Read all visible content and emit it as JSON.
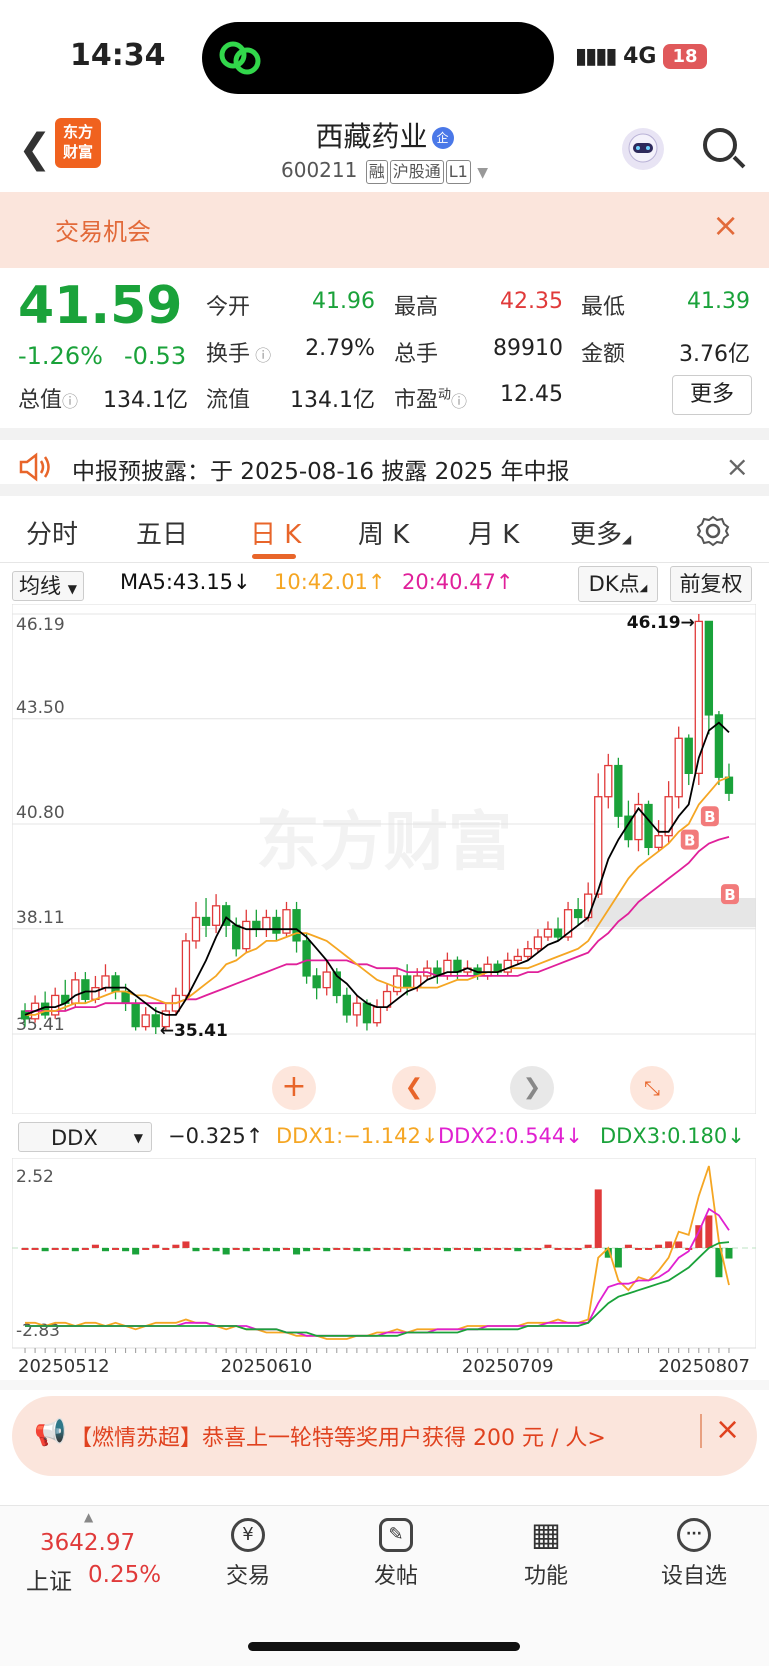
{
  "status": {
    "time": "14:34",
    "network": "4G",
    "battery": "18"
  },
  "header": {
    "logo": "东方\n财富",
    "stock_name": "西藏药业",
    "qi_badge": "企",
    "code": "600211",
    "tags": [
      "融",
      "沪股通",
      "L1"
    ]
  },
  "banner": {
    "text": "交易机会",
    "close": "×"
  },
  "quote": {
    "price": "41.59",
    "change_pct": "-1.26%",
    "change_amt": "-0.53",
    "items": [
      {
        "label": "今开",
        "value": "41.96",
        "color": "#1aa23a"
      },
      {
        "label": "最高",
        "value": "42.35",
        "color": "#e03a3a"
      },
      {
        "label": "最低",
        "value": "41.39",
        "color": "#1aa23a"
      },
      {
        "label": "换手",
        "value": "2.79%",
        "color": "#222222"
      },
      {
        "label": "总手",
        "value": "89910",
        "color": "#222222"
      },
      {
        "label": "金额",
        "value": "3.76亿",
        "color": "#222222"
      },
      {
        "label": "总值",
        "value": "134.1亿",
        "color": "#222222"
      },
      {
        "label": "流值",
        "value": "134.1亿",
        "color": "#222222"
      },
      {
        "label": "市盈",
        "value": "12.45",
        "color": "#222222"
      }
    ],
    "dyn_sup": "动",
    "more": "更多"
  },
  "notice": {
    "text": "中报预披露：于 2025-08-16 披露 2025 年中报",
    "close": "×"
  },
  "tabs": [
    "分时",
    "五日",
    "日 K",
    "周 K",
    "月 K",
    "更多"
  ],
  "active_tab": "日 K",
  "ma_bar": {
    "selector": "均线",
    "ma5": "MA5:43.15↓",
    "ma10": "10:42.01↑",
    "ma20": "20:40.47↑",
    "dk": "DK点",
    "fq": "前复权"
  },
  "ddx_bar": {
    "selector": "DDX",
    "ddx": "−0.325↑",
    "ddx1": "DDX1:−1.142↓",
    "ddx2": "DDX2:0.544↓",
    "ddx3": "DDX3:0.180↓"
  },
  "watermark": "东方财富",
  "chart_data": [
    {
      "type": "candlestick",
      "y_ticks": [
        "46.19",
        "43.50",
        "40.80",
        "38.11",
        "35.41"
      ],
      "ylim": [
        35.41,
        46.19
      ],
      "max_label": "46.19→",
      "min_label": "←35.41",
      "x_ticks": [
        "20250512",
        "20250610",
        "20250709",
        "20250807"
      ],
      "candles": [
        [
          36.0,
          35.8,
          36.2,
          35.6
        ],
        [
          35.8,
          36.2,
          36.4,
          35.7
        ],
        [
          36.2,
          35.9,
          36.5,
          35.8
        ],
        [
          35.9,
          36.4,
          36.6,
          35.8
        ],
        [
          36.4,
          36.2,
          36.8,
          36.0
        ],
        [
          36.2,
          36.8,
          37.0,
          36.1
        ],
        [
          36.8,
          36.3,
          37.0,
          36.2
        ],
        [
          36.3,
          36.6,
          36.9,
          36.2
        ],
        [
          36.6,
          36.9,
          37.2,
          36.5
        ],
        [
          36.9,
          36.5,
          37.0,
          36.3
        ],
        [
          36.5,
          36.2,
          36.7,
          36.0
        ],
        [
          36.2,
          35.6,
          36.3,
          35.5
        ],
        [
          35.6,
          35.9,
          36.1,
          35.5
        ],
        [
          35.9,
          35.6,
          36.1,
          35.41
        ],
        [
          35.6,
          36.0,
          36.2,
          35.5
        ],
        [
          36.0,
          36.4,
          36.6,
          35.9
        ],
        [
          36.4,
          37.8,
          38.0,
          36.3
        ],
        [
          37.8,
          38.4,
          38.8,
          37.6
        ],
        [
          38.4,
          38.2,
          38.9,
          37.9
        ],
        [
          38.2,
          38.7,
          39.0,
          38.0
        ],
        [
          38.7,
          38.2,
          38.8,
          37.9
        ],
        [
          38.2,
          37.6,
          38.4,
          37.4
        ],
        [
          37.6,
          38.3,
          38.6,
          37.5
        ],
        [
          38.3,
          38.1,
          38.6,
          37.9
        ],
        [
          38.1,
          38.4,
          38.6,
          37.9
        ],
        [
          38.4,
          38.0,
          38.6,
          37.8
        ],
        [
          38.0,
          38.6,
          38.8,
          37.9
        ],
        [
          38.6,
          37.8,
          38.8,
          37.5
        ],
        [
          37.8,
          36.9,
          38.0,
          36.7
        ],
        [
          36.9,
          36.6,
          37.1,
          36.3
        ],
        [
          36.6,
          37.0,
          37.3,
          36.4
        ],
        [
          37.0,
          36.4,
          37.1,
          36.2
        ],
        [
          36.4,
          35.9,
          36.6,
          35.7
        ],
        [
          35.9,
          36.2,
          36.4,
          35.6
        ],
        [
          36.2,
          35.7,
          36.3,
          35.5
        ],
        [
          35.7,
          36.1,
          36.3,
          35.6
        ],
        [
          36.1,
          36.5,
          36.7,
          36.0
        ],
        [
          36.5,
          36.9,
          37.1,
          36.4
        ],
        [
          36.9,
          36.6,
          37.2,
          36.4
        ],
        [
          36.6,
          36.9,
          37.1,
          36.5
        ],
        [
          36.9,
          37.1,
          37.3,
          36.8
        ],
        [
          37.1,
          36.9,
          37.3,
          36.7
        ],
        [
          36.9,
          37.3,
          37.5,
          36.8
        ],
        [
          37.3,
          37.0,
          37.4,
          36.8
        ],
        [
          37.0,
          37.1,
          37.3,
          36.9
        ],
        [
          37.1,
          36.9,
          37.2,
          36.8
        ],
        [
          36.9,
          37.2,
          37.4,
          36.8
        ],
        [
          37.2,
          37.0,
          37.3,
          36.9
        ],
        [
          37.0,
          37.3,
          37.5,
          36.9
        ],
        [
          37.3,
          37.4,
          37.6,
          37.2
        ],
        [
          37.4,
          37.6,
          37.8,
          37.3
        ],
        [
          37.6,
          37.9,
          38.1,
          37.5
        ],
        [
          37.9,
          38.1,
          38.3,
          37.8
        ],
        [
          38.1,
          37.9,
          38.4,
          37.8
        ],
        [
          37.9,
          38.6,
          38.8,
          37.8
        ],
        [
          38.6,
          38.4,
          38.9,
          38.2
        ],
        [
          38.4,
          39.0,
          39.3,
          38.3
        ],
        [
          39.0,
          41.5,
          42.1,
          38.9
        ],
        [
          41.5,
          42.3,
          42.6,
          41.2
        ],
        [
          42.3,
          41.0,
          42.5,
          40.7
        ],
        [
          41.0,
          40.4,
          41.4,
          40.2
        ],
        [
          40.4,
          41.3,
          41.6,
          40.1
        ],
        [
          41.3,
          40.2,
          41.4,
          40.0
        ],
        [
          40.2,
          40.5,
          40.9,
          40.1
        ],
        [
          40.5,
          41.5,
          41.9,
          40.3
        ],
        [
          41.5,
          43.0,
          43.3,
          41.2
        ],
        [
          43.0,
          42.1,
          43.1,
          41.8
        ],
        [
          42.1,
          46.0,
          46.19,
          41.8
        ],
        [
          46.0,
          43.6,
          46.0,
          43.1
        ],
        [
          43.6,
          42.0,
          43.7,
          41.8
        ],
        [
          42.0,
          41.59,
          42.35,
          41.39
        ]
      ],
      "ma5": [
        35.9,
        36.0,
        36.1,
        36.1,
        36.2,
        36.4,
        36.5,
        36.5,
        36.6,
        36.6,
        36.6,
        36.4,
        36.2,
        36.0,
        35.9,
        35.9,
        36.3,
        36.8,
        37.3,
        37.9,
        38.4,
        38.2,
        38.1,
        38.1,
        38.1,
        38.1,
        38.1,
        38.1,
        37.9,
        37.6,
        37.3,
        36.9,
        36.7,
        36.4,
        36.2,
        36.1,
        36.1,
        36.3,
        36.5,
        36.6,
        36.8,
        36.9,
        37.0,
        37.0,
        37.1,
        37.0,
        37.0,
        37.0,
        37.1,
        37.2,
        37.3,
        37.5,
        37.7,
        37.8,
        38.0,
        38.2,
        38.4,
        39.1,
        39.9,
        40.4,
        40.8,
        41.2,
        40.9,
        40.6,
        40.6,
        41.0,
        41.3,
        42.5,
        43.2,
        43.4,
        43.15
      ],
      "ma10": [
        35.9,
        35.9,
        36.0,
        36.0,
        36.1,
        36.2,
        36.2,
        36.3,
        36.4,
        36.5,
        36.5,
        36.4,
        36.4,
        36.3,
        36.2,
        36.2,
        36.3,
        36.5,
        36.7,
        36.9,
        37.2,
        37.3,
        37.5,
        37.6,
        37.8,
        37.8,
        37.9,
        38.0,
        38.0,
        37.9,
        37.8,
        37.6,
        37.4,
        37.2,
        37.0,
        36.8,
        36.7,
        36.6,
        36.6,
        36.6,
        36.6,
        36.6,
        36.7,
        36.8,
        36.8,
        36.9,
        37.0,
        37.0,
        37.1,
        37.1,
        37.1,
        37.2,
        37.3,
        37.4,
        37.5,
        37.6,
        37.8,
        38.2,
        38.6,
        39.0,
        39.4,
        39.7,
        39.9,
        40.1,
        40.3,
        40.6,
        40.8,
        41.3,
        41.6,
        41.9,
        42.01
      ],
      "ma20": [
        36.0,
        36.0,
        36.0,
        36.0,
        36.0,
        36.1,
        36.1,
        36.1,
        36.2,
        36.2,
        36.2,
        36.2,
        36.2,
        36.2,
        36.2,
        36.2,
        36.3,
        36.3,
        36.4,
        36.5,
        36.6,
        36.7,
        36.8,
        36.9,
        37.0,
        37.1,
        37.2,
        37.2,
        37.3,
        37.3,
        37.3,
        37.3,
        37.3,
        37.2,
        37.2,
        37.1,
        37.1,
        37.1,
        37.0,
        37.0,
        37.0,
        36.9,
        36.9,
        36.9,
        36.9,
        36.9,
        36.9,
        36.9,
        36.9,
        36.9,
        37.0,
        37.0,
        37.1,
        37.2,
        37.3,
        37.4,
        37.5,
        37.8,
        38.0,
        38.3,
        38.5,
        38.8,
        39.0,
        39.2,
        39.4,
        39.6,
        39.8,
        40.1,
        40.3,
        40.4,
        40.47
      ],
      "ddx_ticks": [
        "2.52",
        "-2.83"
      ],
      "ddx_ylim": [
        -2.83,
        2.52
      ],
      "ddx_bars": [
        0.0,
        0.0,
        -0.1,
        0.0,
        0.0,
        -0.1,
        0.0,
        0.1,
        -0.1,
        0.0,
        -0.1,
        -0.2,
        0.0,
        0.1,
        0.0,
        0.1,
        0.2,
        -0.1,
        0.0,
        -0.1,
        -0.2,
        0.0,
        -0.1,
        0.0,
        -0.1,
        -0.1,
        0.0,
        -0.2,
        -0.1,
        0.0,
        -0.1,
        0.0,
        0.0,
        -0.1,
        -0.1,
        0.0,
        0.0,
        0.0,
        -0.1,
        0.0,
        0.0,
        0.0,
        -0.1,
        0.0,
        0.0,
        -0.1,
        0.0,
        0.0,
        0.0,
        -0.1,
        0.0,
        0.0,
        0.1,
        0.0,
        0.0,
        0.0,
        0.1,
        1.8,
        -0.3,
        -0.6,
        0.1,
        0.0,
        0.0,
        0.1,
        0.2,
        0.2,
        0.0,
        0.7,
        1.0,
        -0.9,
        -0.325
      ],
      "ddx1": [
        -2.3,
        -2.3,
        -2.4,
        -2.3,
        -2.3,
        -2.4,
        -2.3,
        -2.3,
        -2.4,
        -2.3,
        -2.4,
        -2.5,
        -2.4,
        -2.3,
        -2.3,
        -2.3,
        -2.2,
        -2.3,
        -2.3,
        -2.4,
        -2.5,
        -2.4,
        -2.5,
        -2.5,
        -2.6,
        -2.6,
        -2.6,
        -2.7,
        -2.7,
        -2.7,
        -2.8,
        -2.8,
        -2.8,
        -2.7,
        -2.7,
        -2.6,
        -2.6,
        -2.5,
        -2.6,
        -2.5,
        -2.5,
        -2.5,
        -2.5,
        -2.5,
        -2.4,
        -2.4,
        -2.4,
        -2.4,
        -2.4,
        -2.4,
        -2.3,
        -2.3,
        -2.3,
        -2.2,
        -2.3,
        -2.3,
        -2.2,
        -0.3,
        0.0,
        -1.0,
        -1.3,
        -0.9,
        -1.0,
        -0.7,
        -0.3,
        0.5,
        0.4,
        1.6,
        2.52,
        0.2,
        -1.142
      ],
      "ddx2": [
        -2.4,
        -2.4,
        -2.4,
        -2.4,
        -2.4,
        -2.4,
        -2.4,
        -2.4,
        -2.4,
        -2.4,
        -2.4,
        -2.4,
        -2.4,
        -2.4,
        -2.4,
        -2.4,
        -2.3,
        -2.3,
        -2.3,
        -2.4,
        -2.4,
        -2.4,
        -2.4,
        -2.5,
        -2.5,
        -2.5,
        -2.6,
        -2.6,
        -2.7,
        -2.7,
        -2.7,
        -2.7,
        -2.7,
        -2.7,
        -2.7,
        -2.7,
        -2.6,
        -2.6,
        -2.6,
        -2.6,
        -2.6,
        -2.5,
        -2.5,
        -2.5,
        -2.5,
        -2.5,
        -2.4,
        -2.4,
        -2.4,
        -2.4,
        -2.4,
        -2.4,
        -2.3,
        -2.3,
        -2.3,
        -2.3,
        -2.3,
        -1.7,
        -1.2,
        -1.1,
        -1.1,
        -1.0,
        -1.0,
        -0.9,
        -0.7,
        -0.3,
        -0.1,
        0.5,
        1.2,
        1.0,
        0.544
      ],
      "ddx3": [
        -2.4,
        -2.4,
        -2.4,
        -2.4,
        -2.4,
        -2.4,
        -2.4,
        -2.4,
        -2.4,
        -2.4,
        -2.4,
        -2.4,
        -2.4,
        -2.4,
        -2.4,
        -2.4,
        -2.4,
        -2.4,
        -2.4,
        -2.4,
        -2.4,
        -2.4,
        -2.5,
        -2.5,
        -2.5,
        -2.5,
        -2.6,
        -2.6,
        -2.6,
        -2.7,
        -2.7,
        -2.7,
        -2.7,
        -2.7,
        -2.7,
        -2.7,
        -2.7,
        -2.7,
        -2.6,
        -2.6,
        -2.6,
        -2.6,
        -2.6,
        -2.6,
        -2.5,
        -2.5,
        -2.5,
        -2.5,
        -2.5,
        -2.5,
        -2.4,
        -2.4,
        -2.4,
        -2.4,
        -2.4,
        -2.4,
        -2.3,
        -2.0,
        -1.7,
        -1.5,
        -1.4,
        -1.3,
        -1.2,
        -1.1,
        -1.0,
        -0.8,
        -0.6,
        -0.3,
        0.0,
        0.15,
        0.18
      ]
    }
  ],
  "ad": {
    "text": "【燃情苏超】恭喜上一轮特等奖用户获得 200 元 / 人>",
    "close": "×"
  },
  "tabbar": {
    "index_value": "3642.97",
    "index_name": "上证",
    "index_change": "0.25%",
    "items": [
      {
        "label": "交易",
        "icon": "trade-icon",
        "glyph": "¥"
      },
      {
        "label": "发帖",
        "icon": "post-icon",
        "glyph": "✎"
      },
      {
        "label": "功能",
        "icon": "apps-icon",
        "glyph": "▦"
      },
      {
        "label": "设自选",
        "icon": "more-icon",
        "glyph": "···"
      }
    ]
  },
  "colors": {
    "up": "#e03a3a",
    "down": "#1aa23a",
    "accent": "#e8652a",
    "ma5": "#000000",
    "ma10": "#f5a623",
    "ma20": "#e0209a"
  }
}
